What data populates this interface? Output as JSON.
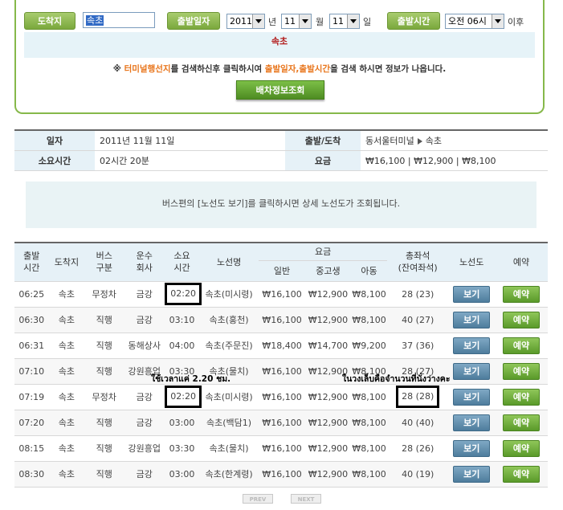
{
  "search": {
    "dest_label": "도착지",
    "dest_value": "속초",
    "date_label": "출발일자",
    "year": "2011",
    "year_unit": "년",
    "month": "11",
    "month_unit": "월",
    "day": "11",
    "day_unit": "일",
    "time_label": "출발시간",
    "time_value": "오전 06시",
    "time_suffix": "이후",
    "selected_dest": "속초",
    "notice_prefix": "※",
    "notice_part1": "터미널행선지",
    "notice_part2": "를 검색하신후 클릭하시여",
    "notice_part3": "출발일자,출발시간",
    "notice_part4": "을 검색 하시면 정보가 나옵니다.",
    "query_button": "배차정보조회"
  },
  "info": {
    "date_label": "일자",
    "date_value": "2011년 11월 11일",
    "route_label": "출발/도착",
    "route_from": "동서울터미널",
    "route_to": "속초",
    "duration_label": "소요시간",
    "duration_value": "02시간 20분",
    "fare_label": "요금",
    "fare_value": "₩16,100 | ₩12,900 | ₩8,100"
  },
  "route_notice": "버스편의 [노선도 보기]를 클릭하시면 상세 노선도가 조회됩니다.",
  "table": {
    "headers": {
      "depart": "출발\n시간",
      "dest": "도착지",
      "bus_type": "버스\n구분",
      "company": "운수\n회사",
      "duration": "소요\n시간",
      "route_name": "노선명",
      "fare": "요금",
      "adult": "일반",
      "youth": "중고생",
      "child": "아동",
      "seats": "총좌석\n(잔여좌석)",
      "route_map": "노선도",
      "reserve": "예약"
    },
    "view_label": "보기",
    "book_label": "예약",
    "rows": [
      {
        "time": "06:25",
        "dest": "속초",
        "type": "무정차",
        "company": "금강",
        "duration": "02:20",
        "route": "속초(미시령)",
        "adult": "₩16,100",
        "youth": "₩12,900",
        "child": "₩8,100",
        "seats": "28 (23)"
      },
      {
        "time": "06:30",
        "dest": "속초",
        "type": "직행",
        "company": "금강",
        "duration": "03:10",
        "route": "속초(홍천)",
        "adult": "₩16,100",
        "youth": "₩12,900",
        "child": "₩8,100",
        "seats": "40 (27)"
      },
      {
        "time": "06:31",
        "dest": "속초",
        "type": "직행",
        "company": "동해상사",
        "duration": "04:00",
        "route": "속초(주문진)",
        "adult": "₩18,400",
        "youth": "₩14,700",
        "child": "₩9,200",
        "seats": "37 (36)"
      },
      {
        "time": "07:10",
        "dest": "속초",
        "type": "직행",
        "company": "강원흥업",
        "duration": "03:30",
        "route": "속초(물치)",
        "adult": "₩16,100",
        "youth": "₩12,900",
        "child": "₩8,100",
        "seats": "28 (27)"
      },
      {
        "time": "07:19",
        "dest": "속초",
        "type": "무정차",
        "company": "금강",
        "duration": "02:20",
        "route": "속초(미시령)",
        "adult": "₩16,100",
        "youth": "₩12,900",
        "child": "₩8,100",
        "seats": "28 (28)"
      },
      {
        "time": "07:20",
        "dest": "속초",
        "type": "직행",
        "company": "금강",
        "duration": "03:00",
        "route": "속초(백담1)",
        "adult": "₩16,100",
        "youth": "₩12,900",
        "child": "₩8,100",
        "seats": "40 (40)"
      },
      {
        "time": "08:15",
        "dest": "속초",
        "type": "직행",
        "company": "강원흥업",
        "duration": "03:30",
        "route": "속초(물치)",
        "adult": "₩16,100",
        "youth": "₩12,900",
        "child": "₩8,100",
        "seats": "28 (26)"
      },
      {
        "time": "08:30",
        "dest": "속초",
        "type": "직행",
        "company": "금강",
        "duration": "03:00",
        "route": "속초(한계령)",
        "adult": "₩16,100",
        "youth": "₩12,900",
        "child": "₩8,100",
        "seats": "40 (19)"
      }
    ]
  },
  "annotations": {
    "duration_note": "ใช้เวลาแค่ 2.20 ชม.",
    "seats_note": "ในวงเล็บคือจำนวนที่นั่งว่างคะ"
  },
  "pager": {
    "prev": "PREV",
    "next": "NEXT"
  }
}
